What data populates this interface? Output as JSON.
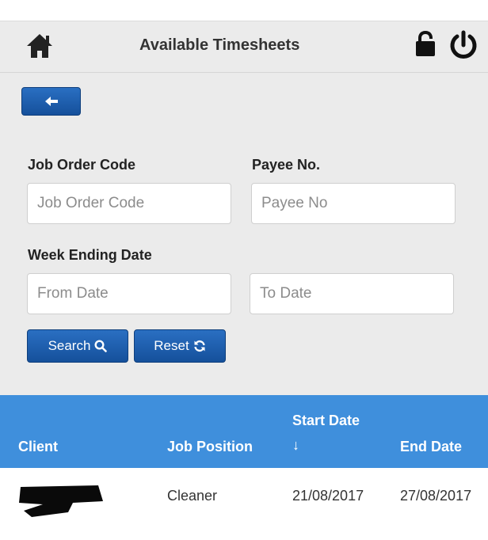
{
  "header": {
    "title": "Available Timesheets",
    "home_icon": "home-icon",
    "lock_icon": "unlock-icon",
    "power_icon": "power-icon"
  },
  "toolbar": {
    "back_icon": "arrow-left-icon"
  },
  "filters": {
    "job_order_code": {
      "label": "Job Order Code",
      "placeholder": "Job Order Code",
      "value": ""
    },
    "payee_no": {
      "label": "Payee No.",
      "placeholder": "Payee No",
      "value": ""
    },
    "week_ending_date": {
      "label": "Week Ending Date",
      "from_placeholder": "From Date",
      "to_placeholder": "To Date"
    },
    "search_label": "Search",
    "reset_label": "Reset"
  },
  "table": {
    "columns": [
      "Client",
      "Job Position",
      "Start Date",
      "End Date"
    ],
    "sort_indicator": "↓",
    "rows": [
      {
        "client": "",
        "job_position": "Cleaner",
        "start_date": "21/08/2017",
        "end_date": "27/08/2017"
      }
    ]
  },
  "colors": {
    "accent": "#15509b",
    "table_header": "#3f8fdc",
    "panel": "#ebebeb"
  }
}
